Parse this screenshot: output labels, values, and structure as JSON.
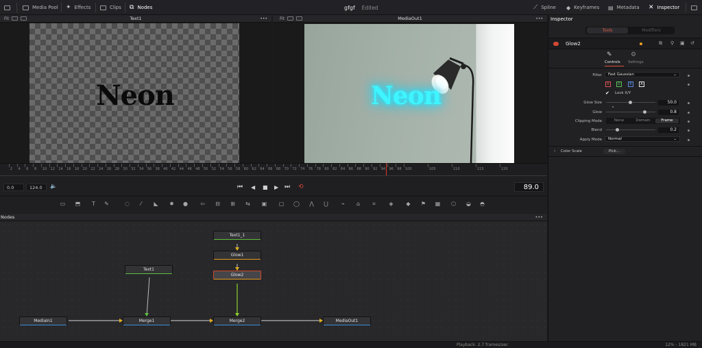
{
  "topbar": {
    "left_items": [
      "Media Pool",
      "Effects",
      "Clips",
      "Nodes"
    ],
    "project_title": "gfgf",
    "project_status": "Edited",
    "right_items": [
      "Spline",
      "Keyframes",
      "Metadata",
      "Inspector"
    ]
  },
  "viewers": {
    "left_title": "Text1",
    "right_title": "MediaOut1",
    "left_fit": "Fit",
    "right_fit": "Fit",
    "left_text": "Neon",
    "right_text": "Neon"
  },
  "ruler_labels": [
    "2",
    "4",
    "6",
    "8",
    "10",
    "12",
    "14",
    "16",
    "18",
    "20",
    "22",
    "24",
    "26",
    "28",
    "30",
    "32",
    "34",
    "36",
    "38",
    "40",
    "42",
    "44",
    "46",
    "48",
    "50",
    "52",
    "54",
    "56",
    "58",
    "60",
    "62",
    "64",
    "66",
    "68",
    "70",
    "72",
    "74",
    "76",
    "78",
    "80",
    "82",
    "84",
    "86",
    "88",
    "90",
    "92",
    "94",
    "96",
    "98",
    "100",
    "105",
    "110",
    "115",
    "120"
  ],
  "transport": {
    "start": "0.0",
    "end": "124.0",
    "current_frame": "89.0"
  },
  "nodes_panel": {
    "title": "Nodes",
    "nodes": [
      "Text1_1",
      "Glow1",
      "Glow2",
      "Text1",
      "MediaIn1",
      "Merge1",
      "Merge2",
      "MediaOut1"
    ]
  },
  "inspector": {
    "title": "Inspector",
    "tab_tools": "Tools",
    "tab_modifiers": "Modifiers",
    "node_name": "Glow2",
    "subtab_controls": "Controls",
    "subtab_settings": "Settings",
    "filter_label": "Filter",
    "filter_value": "Fast Gaussian",
    "channels": [
      "R",
      "G",
      "B",
      "A"
    ],
    "lock_xy": "Lock X/Y",
    "glow_size_label": "Glow Size",
    "glow_size_value": "50.0",
    "glow_label": "Glow",
    "glow_value": "0.8",
    "clipping_mode_label": "Clipping Mode",
    "clipping_options": [
      "None",
      "Domain",
      "Frame"
    ],
    "clipping_selected": "Frame",
    "blend_label": "Blend",
    "blend_value": "0.2",
    "apply_mode_label": "Apply Mode",
    "apply_mode_value": "Normal",
    "color_scale_label": "Color Scale",
    "pick_label": "Pick..."
  },
  "status": {
    "playback": "Playback: 2.7 frames/sec",
    "memory": "12% - 1821 MB"
  }
}
